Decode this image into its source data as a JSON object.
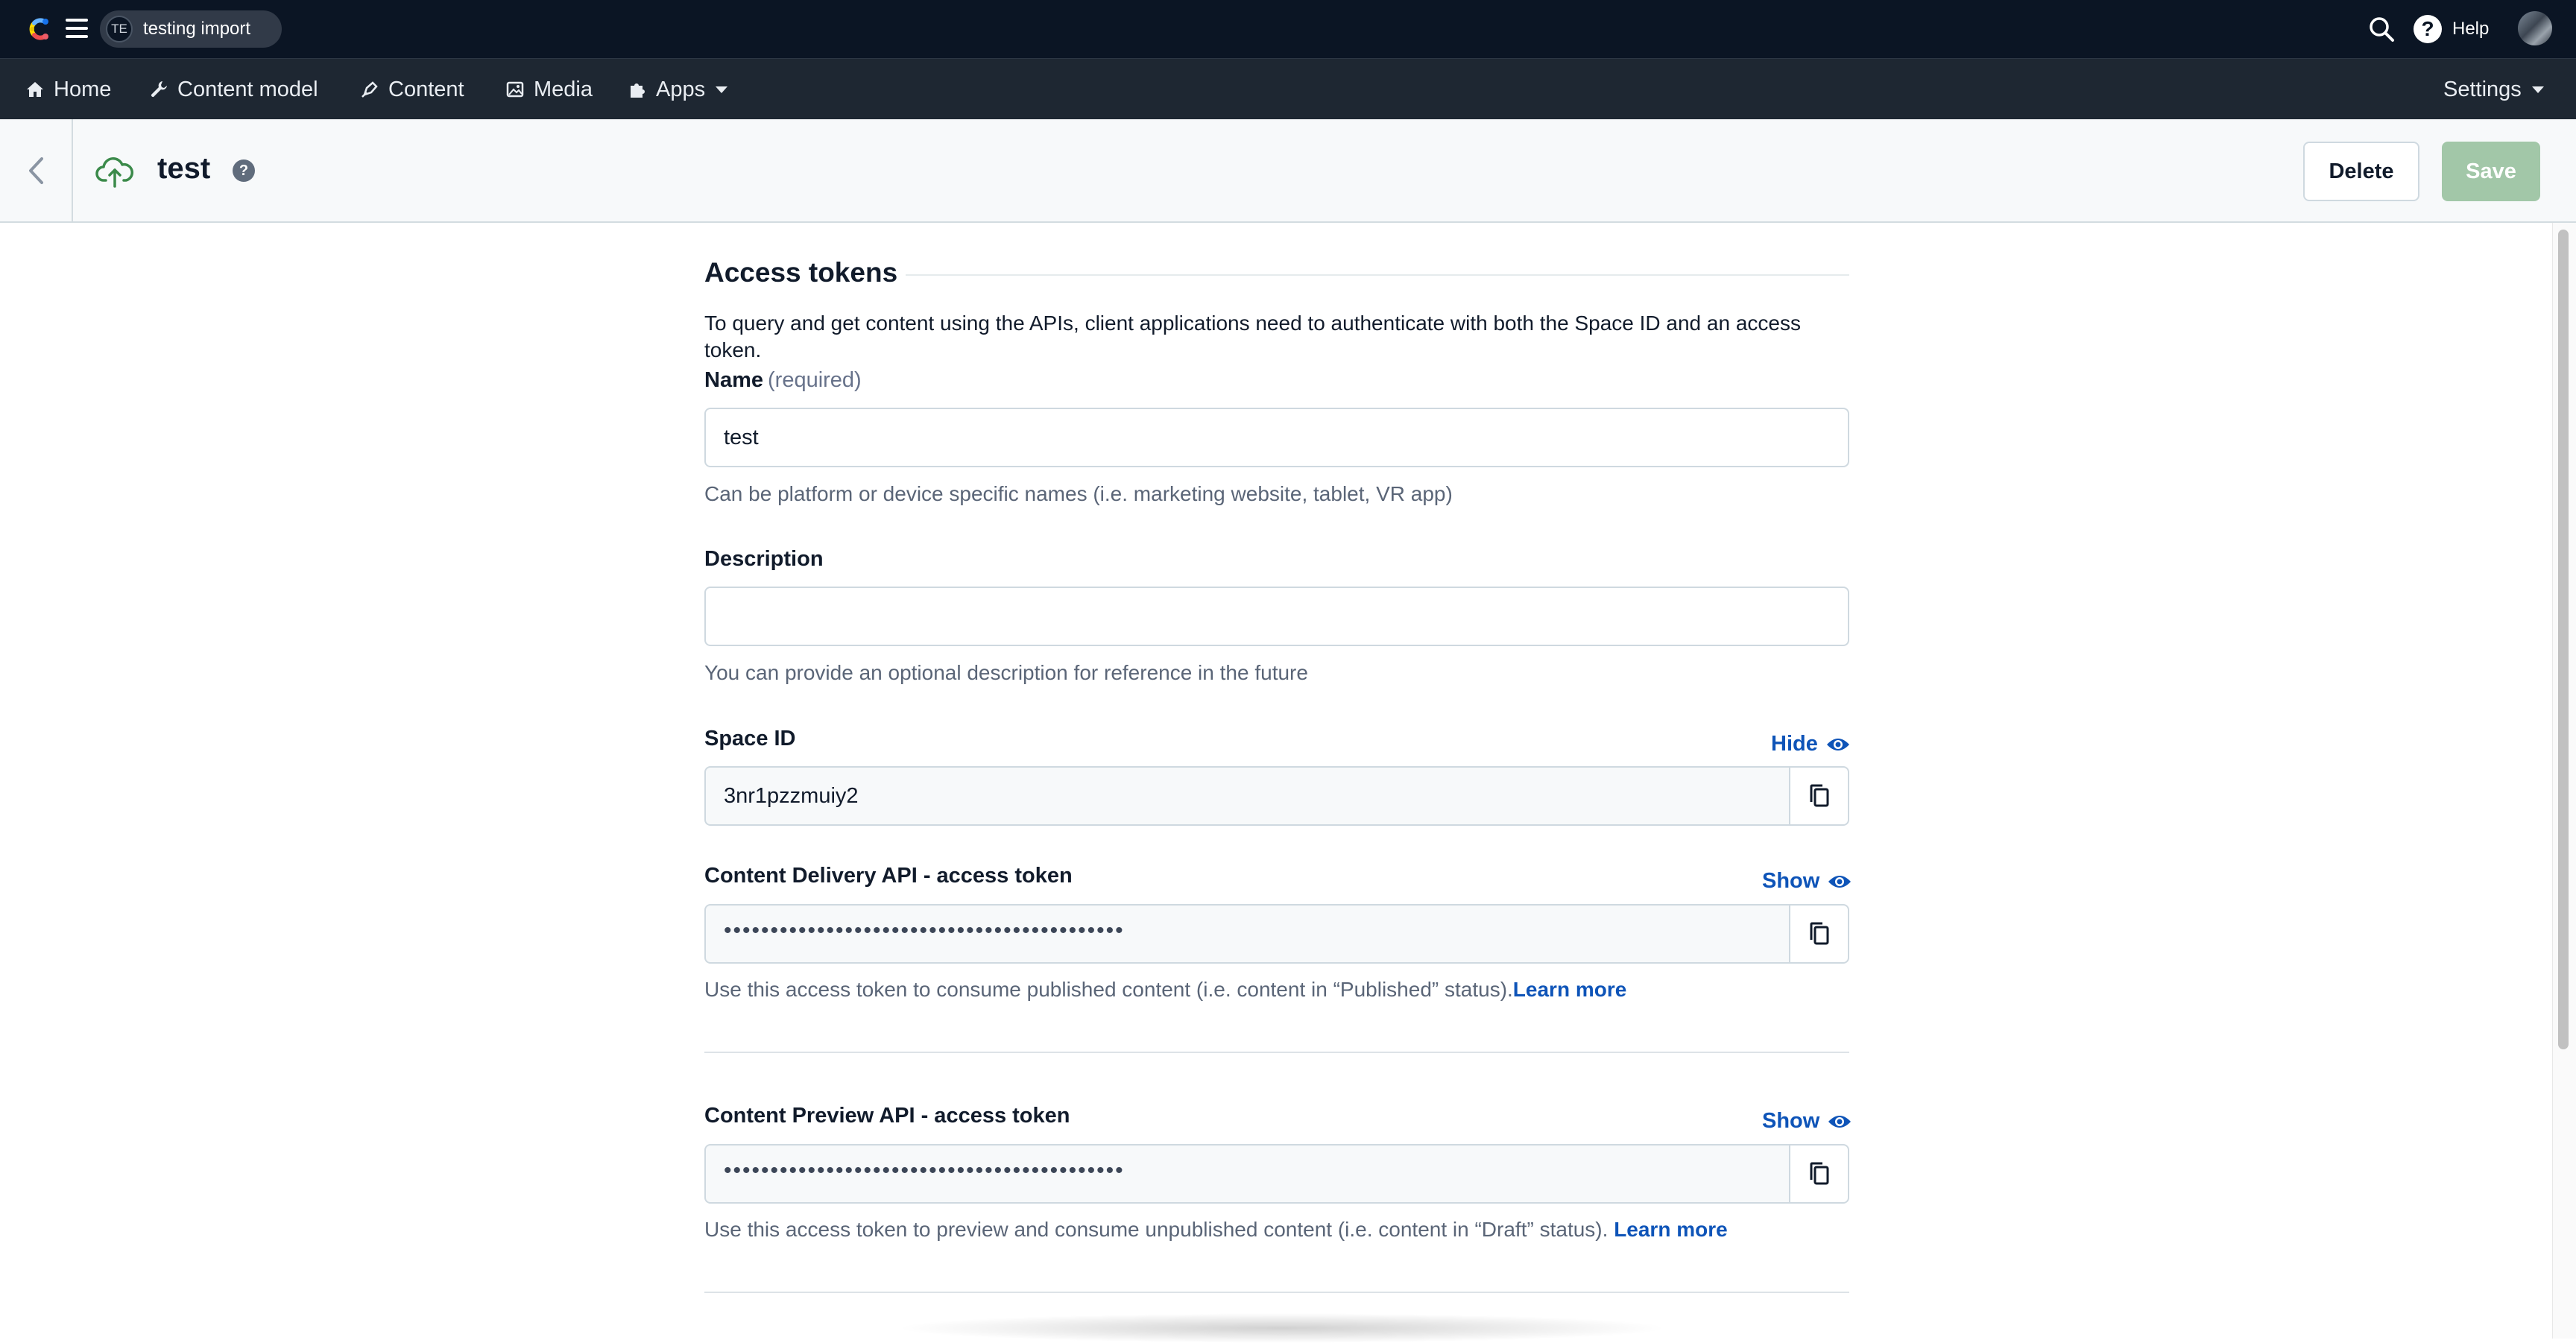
{
  "topbar": {
    "space_initials": "TE",
    "space_name": "testing import",
    "help_label": "Help",
    "help_glyph": "?"
  },
  "nav": {
    "home": "Home",
    "content_model": "Content model",
    "content": "Content",
    "media": "Media",
    "apps": "Apps",
    "settings": "Settings"
  },
  "entity": {
    "title": "test",
    "help_glyph": "?",
    "delete_label": "Delete",
    "save_label": "Save"
  },
  "form": {
    "heading": "Access tokens",
    "intro": "To query and get content using the APIs, client applications need to authenticate with both the Space ID and an access token.",
    "name_label": "Name",
    "name_required": "(required)",
    "name_value": "test",
    "name_hint": "Can be platform or device specific names (i.e. marketing website, tablet, VR app)",
    "description_label": "Description",
    "description_value": "",
    "description_hint": "You can provide an optional description for reference in the future",
    "space_id_label": "Space ID",
    "space_id_toggle": "Hide",
    "space_id_value": "3nr1pzzmuiy2",
    "cda_label": "Content Delivery API - access token",
    "cda_toggle": "Show",
    "cda_value": "•••••••••••••••••••••••••••••••••••••••••••",
    "cda_hint": "Use this access token to consume published content (i.e. content in “Published” status).",
    "cda_learn_more": "Learn more",
    "cpa_label": "Content Preview API - access token",
    "cpa_toggle": "Show",
    "cpa_value": "•••••••••••••••••••••••••••••••••••••••••••",
    "cpa_hint": "Use this access token to preview and consume unpublished content (i.e. content in “Draft” status).",
    "cpa_learn_more": "Learn more"
  },
  "colors": {
    "topbar_bg": "#0b1524",
    "navbar_bg": "#1e2732",
    "link_blue": "#0e54b8",
    "save_disabled_green": "#a2c7a8"
  },
  "icons": [
    "contentful-logo-icon",
    "hamburger-menu-icon",
    "search-icon",
    "help-icon",
    "home-icon",
    "wrench-icon",
    "pen-icon",
    "image-icon",
    "puzzle-icon",
    "chevron-left-icon",
    "cloud-upload-icon",
    "eye-icon",
    "copy-icon"
  ]
}
